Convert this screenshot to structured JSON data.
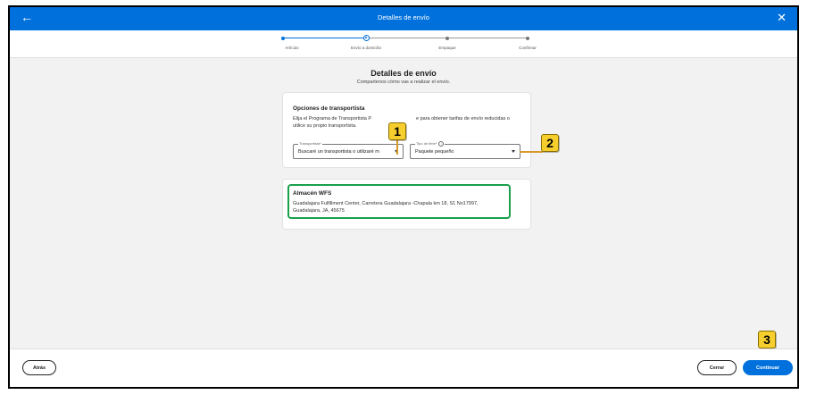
{
  "header": {
    "title": "Detalles de envío"
  },
  "stepper": {
    "steps": [
      {
        "label": "Artículo"
      },
      {
        "label": "Envío a domicilio"
      },
      {
        "label": "Empaque"
      },
      {
        "label": "Confirmar"
      }
    ]
  },
  "page": {
    "heading": "Detalles de envío",
    "subheading": "Compartenos cómo vas a realizar el envío."
  },
  "carrier": {
    "title": "Opciones de transportista",
    "description_line1": "Elija el Programa de Transportista P",
    "description_line1b": "e para obtener tarifas de envío reducidas o",
    "description_line2": "utilice su propio transportista.",
    "carrier_field": {
      "label": "Transportista*",
      "value": "Buscaré un transportista o utilizaré m"
    },
    "rate_field": {
      "label": "Tipo de flete*",
      "value": "Paquete pequeño"
    }
  },
  "warehouse": {
    "title": "Almacén WFS",
    "address_line1": "Guadalajara Fulfillment Center, Carretera Guadalajara -Chapala km 18, S1 No17997,",
    "address_line2": "Guadalajara, JA, 45675"
  },
  "callouts": [
    "1",
    "2",
    "3"
  ],
  "footer": {
    "back_label": "Atrás",
    "close_label": "Cerrar",
    "continue_label": "Continuar"
  },
  "colors": {
    "primary": "#0071dc",
    "highlight": "#1a9f4b",
    "callout": "#f6cf2e"
  }
}
